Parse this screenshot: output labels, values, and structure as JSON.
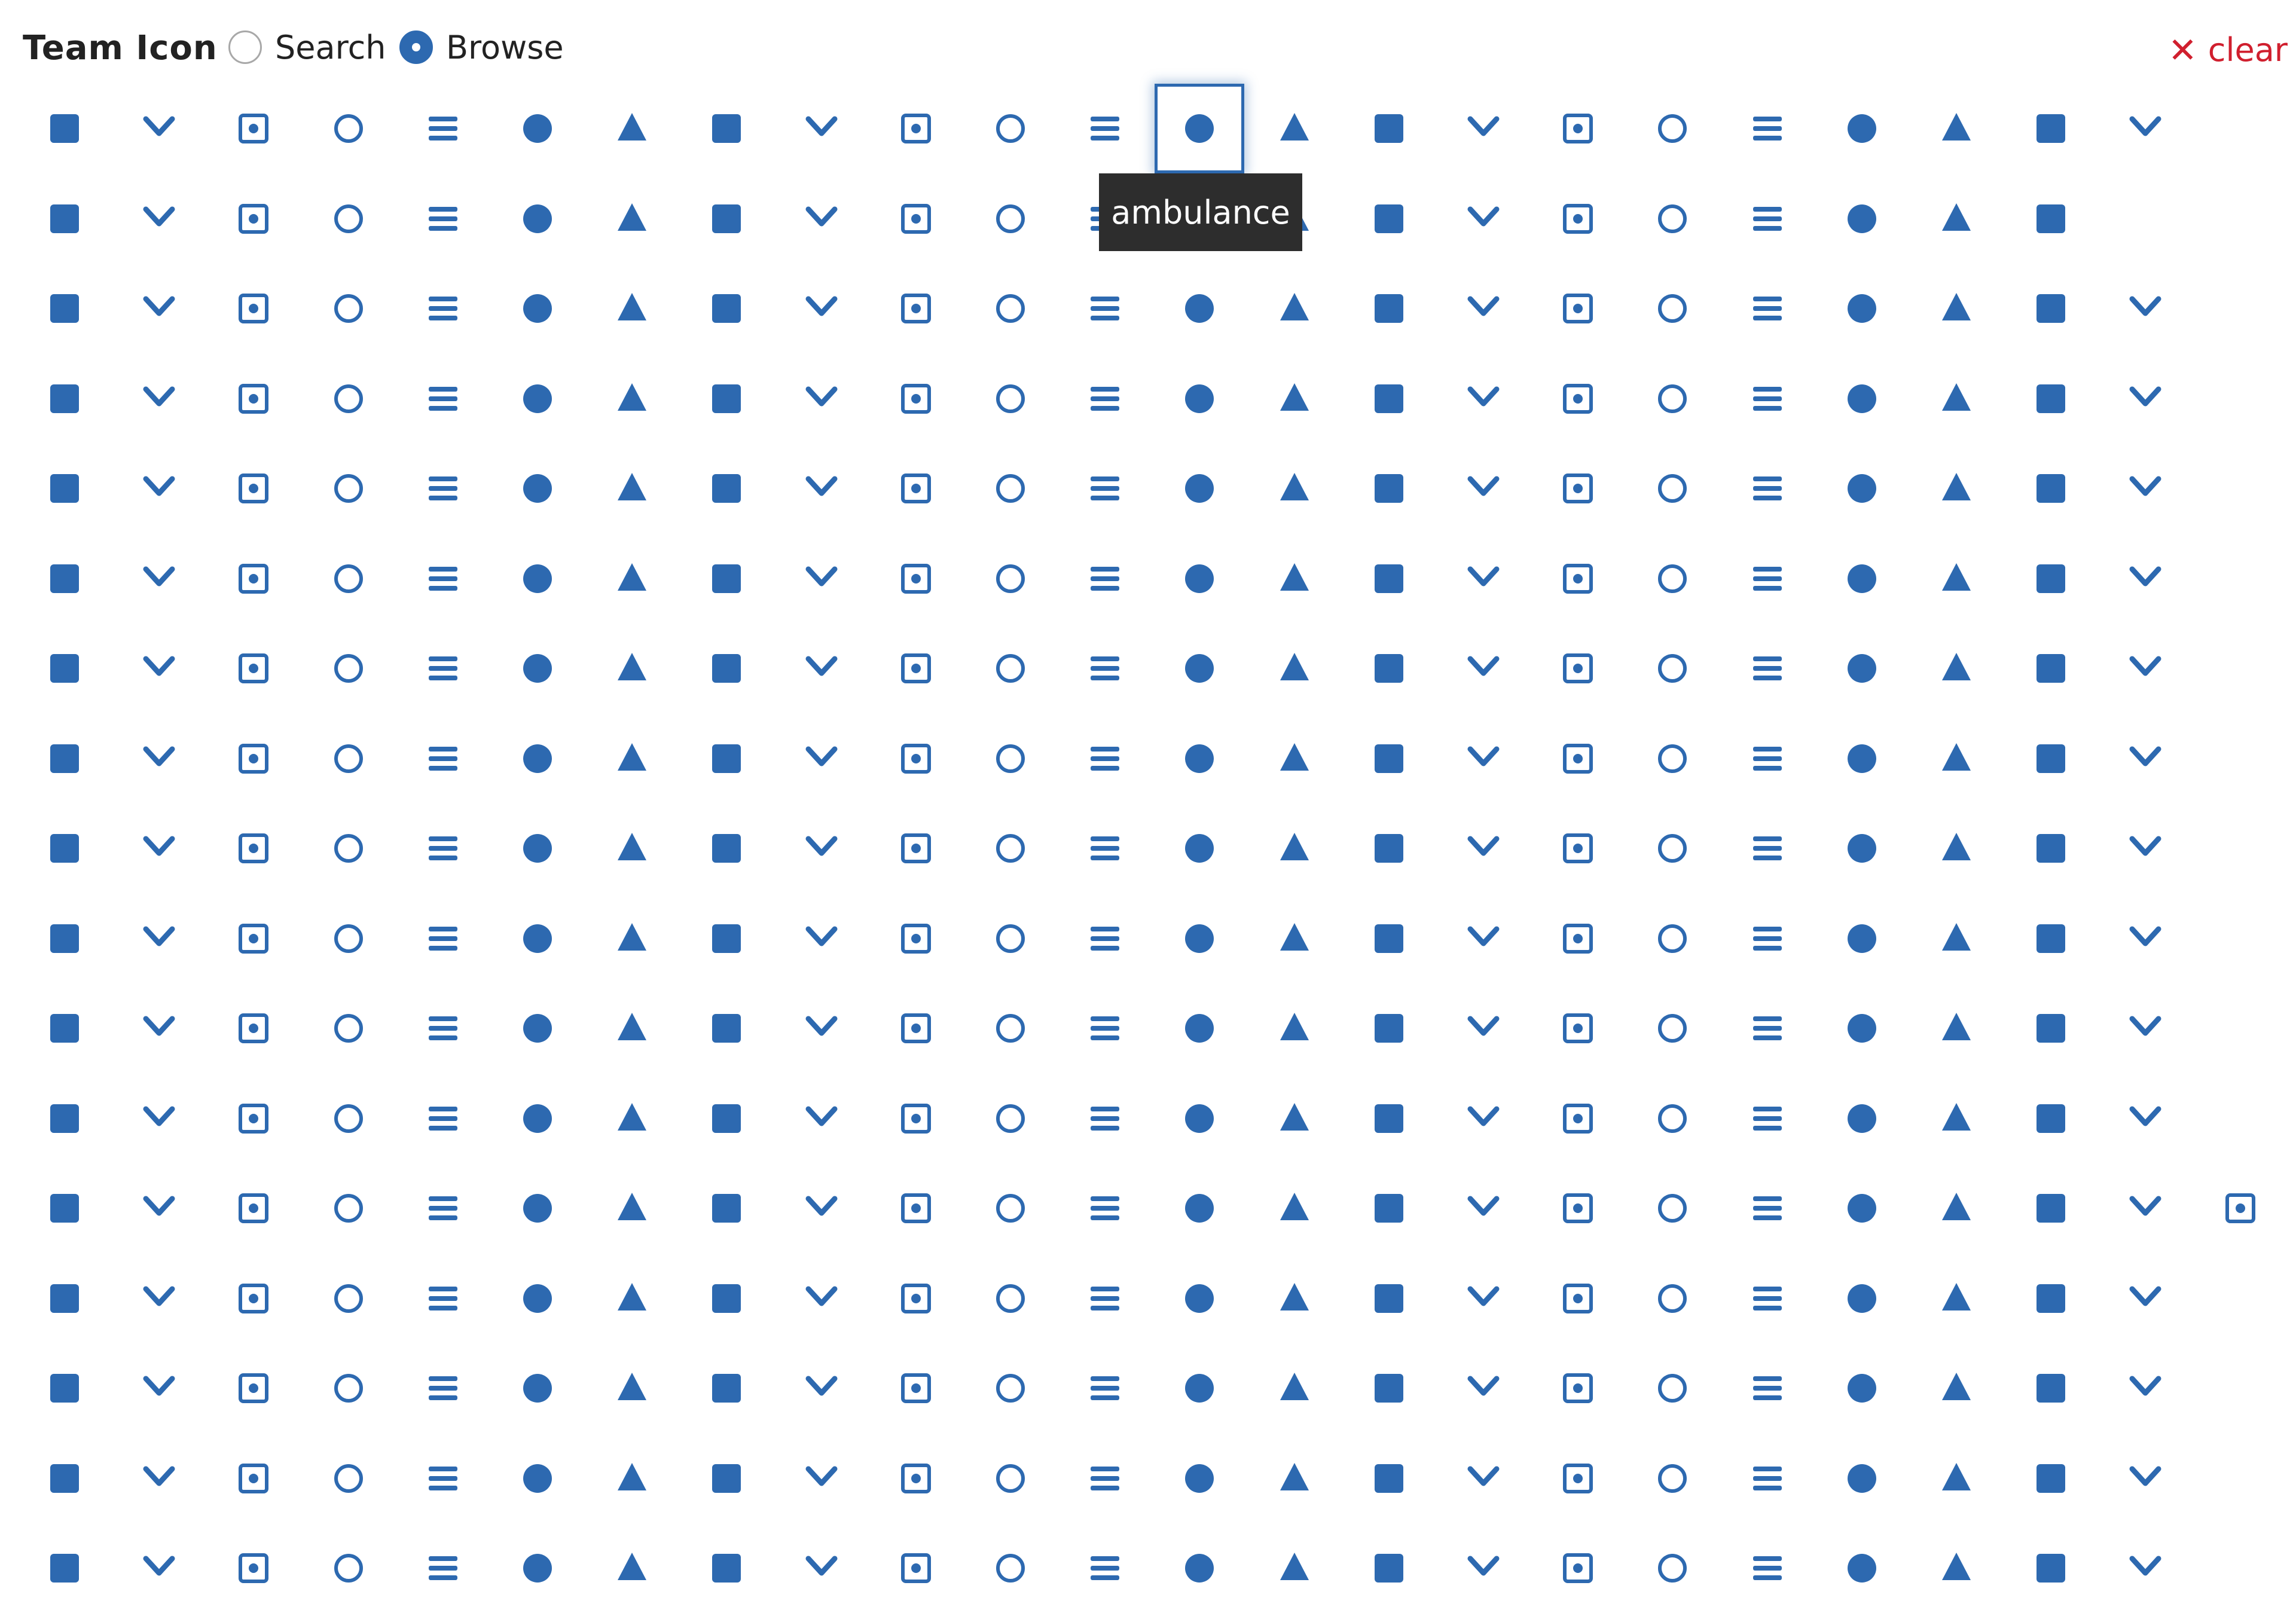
{
  "header": {
    "title": "Team Icon",
    "radio_search": "Search",
    "radio_browse": "Browse",
    "selected_mode": "browse",
    "clear_label": "clear"
  },
  "tooltip": {
    "text": "ambulance"
  },
  "colors": {
    "icon": "#2d69b0",
    "accent": "#2d69b0",
    "clear": "#d01f2e"
  },
  "selected_icon": "ambulance",
  "icon_rows": [
    [
      "ad-icon",
      "address-book-icon",
      "address-book-outline-icon",
      "address-card-icon",
      "address-card-outline-icon",
      "adjust-icon",
      "air-freshener-icon",
      "align-center-icon",
      "align-justify-icon",
      "align-left-icon",
      "align-right-icon",
      "allergies-icon",
      "ambulance-icon",
      "american-sign-language-icon",
      "anchor-icon",
      "angle-double-down-icon",
      "angle-double-down-bold-icon",
      "angle-double-left-icon",
      "angle-double-left-bold-icon",
      "angle-double-right-icon",
      "angle-double-right-bold-icon",
      "angle-double-up-icon",
      "angle-double-up-bold-icon"
    ],
    [
      "angle-down-icon",
      "angle-down-bold-icon",
      "angle-left-icon",
      "angle-left-bold-icon",
      "angle-right-icon",
      "angle-right-bold-icon",
      "angle-up-icon",
      "angle-up-bold-icon",
      "angry-icon",
      "angry-outline-icon",
      "apple-icon",
      "archive-icon",
      "archway-icon",
      "arrow-alt-circle-down-icon",
      "arrow-circle-down-icon",
      "arrow-alt-circle-left-icon",
      "arrow-circle-left-icon",
      "arrow-alt-circle-down-outline-icon",
      "arrow-alt-circle-left-outline-icon",
      "arrow-alt-circle-right-outline-icon",
      "arrow-alt-circle-up-outline-icon",
      "arrow-alt-circle-right-icon"
    ],
    [
      "arrow-circle-right-icon",
      "arrow-circle-up-icon",
      "arrow-alt-circle-up-icon",
      "arrow-down-icon",
      "arrow-left-icon",
      "arrow-right-icon",
      "arrow-up-icon",
      "arrows-alt-icon",
      "expand-arrows-icon",
      "arrows-alt-h-icon",
      "arrows-alt-v-icon",
      "assistive-listening-icon",
      "asterisk-icon",
      "at-icon",
      "atlas-icon",
      "atom-icon",
      "audio-description-icon",
      "award-icon",
      "baby-icon",
      "baby-carriage-icon",
      "backspace-icon",
      "backward-icon",
      "bacon-icon"
    ],
    [
      "bahai-icon",
      "bacterium-icon",
      "balance-scale-icon",
      "balance-scale-left-icon",
      "balance-scale-right-icon",
      "ban-icon",
      "band-aid-icon",
      "barcode-chart-icon",
      "barcode-icon",
      "bars-icon",
      "baseball-icon",
      "basketball-icon",
      "bath-icon",
      "battery-empty-icon",
      "battery-full-icon",
      "battery-half-icon",
      "battery-quarter-icon",
      "battery-three-quarters-icon",
      "bed-icon",
      "beer-icon",
      "bell-icon",
      "bell-outline-icon",
      "bell-slash-icon"
    ],
    [
      "bell-slash-outline-icon",
      "bezier-curve-icon",
      "bicycle-icon",
      "biking-icon",
      "binoculars-icon",
      "biohazard-icon",
      "birthday-cake-icon",
      "blender-icon",
      "blind-icon",
      "blog-icon",
      "bold-icon",
      "bolt-icon",
      "bomb-icon",
      "bone-icon",
      "book-icon",
      "book-dead-icon",
      "book-medical-icon",
      "book-open-icon",
      "book-reader-icon",
      "bookmark-icon",
      "bookmark-outline-icon",
      "border-all-icon",
      "border-none-icon"
    ],
    [
      "border-style-icon",
      "bowling-ball-icon",
      "box-icon",
      "box-open-icon",
      "inbox-box-icon",
      "boxes-icon",
      "braille-icon",
      "brain-icon",
      "bread-slice-icon",
      "briefcase-icon",
      "briefcase-medical-icon",
      "broadcast-tower-icon",
      "broom-icon",
      "brush-icon",
      "bug-icon",
      "building-icon",
      "building-outline-icon",
      "bullhorn-icon",
      "bullseye-icon",
      "bullseye-outline-icon",
      "burn-icon",
      "bus-icon",
      "bus-alt-icon"
    ],
    [
      "business-time-icon",
      "calculator-icon",
      "calendar-icon",
      "calendar-alt-icon",
      "calendar-check-icon",
      "calendar-check-outline-icon",
      "calendar-day-icon",
      "calendar-minus-icon",
      "calendar-minus-outline-icon",
      "calendar-outline-icon",
      "calendar-plus-icon",
      "calendar-plus-outline-icon",
      "calendar-times-icon",
      "calendar-times-outline-icon",
      "calendar-week-icon",
      "camera-icon",
      "camera-retro-icon",
      "campground-icon",
      "candy-cane-icon",
      "capsules-icon",
      "car-icon",
      "car-alt-icon",
      "car-battery-icon"
    ],
    [
      "car-crash-icon",
      "car-side-icon",
      "caravan-icon",
      "caret-down-icon",
      "caret-left-icon",
      "caret-right-icon",
      "caret-square-down-icon",
      "caret-square-left-icon",
      "caret-square-down-outline-icon",
      "caret-square-left-outline-icon",
      "caret-square-right-outline-icon",
      "caret-square-up-outline-icon",
      "caret-square-right-icon",
      "caret-square-up-icon",
      "caret-up-icon",
      "carrot-icon",
      "cart-arrow-down-icon",
      "cart-plus-icon",
      "cash-register-icon",
      "cat-icon",
      "closed-captioning-icon",
      "certificate-icon",
      "chain-broken-icon"
    ],
    [
      "chair-icon",
      "chalkboard-icon",
      "chalkboard-teacher-icon",
      "charging-station-icon",
      "check-icon",
      "check-circle-icon",
      "check-circle-outline-icon",
      "check-double-icon",
      "check-square-icon",
      "check-square-outline-icon",
      "check-square-thin-icon",
      "cheese-icon",
      "chess-icon",
      "chess-bishop-icon",
      "chess-board-icon",
      "chess-king-icon",
      "chess-knight-icon",
      "chess-pawn-icon",
      "chess-queen-icon",
      "chess-rook-icon",
      "chevron-circle-down-icon",
      "chevron-circle-left-icon",
      "chevron-circle-right-icon"
    ],
    [
      "chevron-circle-up-icon",
      "chevron-down-icon",
      "chevron-left-icon",
      "chevron-right-icon",
      "chevron-up-icon",
      "child-icon",
      "circle-icon",
      "circle-large-icon",
      "circle-outline-icon",
      "circle-thin-icon",
      "circle-notch-icon",
      "circle-light-icon",
      "city-icon",
      "clinic-medical-icon",
      "clipboard-copy-icon",
      "clipboard-icon",
      "clipboard-check-icon",
      "clipboard-list-icon",
      "clipboard-outline-icon",
      "clock-icon",
      "clock-outline-icon",
      "clone-outline-icon",
      "clone-icon"
    ],
    [
      "closed-captioning-solid-icon",
      "cloud-icon",
      "cloud-download-icon",
      "cloud-moon-icon",
      "cloud-moon-rain-icon",
      "cloud-rain-icon",
      "cloud-showers-heavy-icon",
      "cloud-sun-icon",
      "cloud-sun-rain-icon",
      "cloud-upload-icon",
      "cocktail-icon",
      "code-icon",
      "code-branch-icon",
      "coffee-icon",
      "cog-icon",
      "cogs-icon",
      "coins-icon",
      "columns-icon",
      "comment-icon",
      "comment-alt-icon",
      "comment-dollar-icon",
      "comment-medical-icon",
      "comment-outline-icon"
    ],
    [
      "comment-alt-outline-icon",
      "comment-slash-icon",
      "comment-dots-icon",
      "comment-dots-outline-icon",
      "comments-icon",
      "comments-dollar-icon",
      "comments-outline-icon",
      "compact-disc-icon",
      "compass-outline-icon",
      "compass-icon",
      "compress-icon",
      "compress-arrows-icon",
      "compress-alt-icon",
      "concierge-bell-icon",
      "cookie-icon",
      "cookie-bite-icon",
      "copyright-outline-icon",
      "copyright-icon",
      "couch-icon",
      "creative-commons-icon",
      "credit-card-icon",
      "credit-card-alt-icon",
      "crop-icon"
    ],
    [
      "crop-alt-icon",
      "crosshairs-icon",
      "crow-icon",
      "crown-icon",
      "crutch-icon",
      "cube-icon",
      "cubes-icon",
      "cutlery-icon",
      "database-icon",
      "deaf-icon",
      "desktop-icon",
      "dharmachakra-icon",
      "diagnoses-icon",
      "gem-outline-icon",
      "dice-icon",
      "dice-d20-icon",
      "dice-d6-icon",
      "dice-five-icon",
      "dice-four-icon",
      "dice-one-icon",
      "dice-six-icon",
      "dice-three-icon",
      "dice-two-icon",
      "digital-tachograph-icon"
    ],
    [
      "directions-icon",
      "disease-icon",
      "divide-icon",
      "dizzy-icon",
      "dizzy-outline-icon",
      "dna-icon",
      "dog-icon",
      "dolly-icon",
      "dolly-flatbed-icon",
      "donate-icon",
      "door-closed-icon",
      "door-open-icon",
      "dot-circle-icon",
      "dot-circle-outline-icon",
      "dot-circle-thin-icon",
      "dove-icon",
      "download-icon",
      "drafting-compass-icon",
      "dragon-icon",
      "draw-polygon-icon",
      "drum-icon",
      "drum-steelpan-icon",
      "drumstick-bite-icon"
    ],
    [
      "dumbbell-icon",
      "dumpster-icon",
      "dungeon-icon",
      "egg-icon",
      "eject-icon",
      "ellipsis-h-icon",
      "ellipsis-v-icon",
      "envelope-icon",
      "envelope-outline-icon",
      "envelope-open-icon",
      "envelope-open-outline-icon",
      "envelope-open-text-icon",
      "envelope-square-icon",
      "equals-icon",
      "eraser-icon",
      "ethernet-icon",
      "euro-sign-icon",
      "exchange-alt-icon",
      "exclamation-icon",
      "exclamation-circle-icon",
      "exclamation-triangle-icon",
      "expand-alt-icon",
      "expand-icon"
    ],
    [
      "external-link-icon",
      "external-link-square-icon",
      "eye-icon",
      "eye-slash-icon",
      "eye-dropper-icon",
      "eye-dropper-solid-icon",
      "fan-icon",
      "fast-backward-icon",
      "fast-forward-icon",
      "faucet-icon",
      "fax-icon",
      "feather-icon",
      "feather-alt-icon",
      "female-icon",
      "fighter-jet-icon",
      "file-icon",
      "file-alt-icon",
      "file-archive-icon",
      "file-audio-icon",
      "file-audio-outline-icon",
      "file-code-icon",
      "file-code-outline-icon",
      "file-contract-icon"
    ],
    [
      "file-csv-icon",
      "file-download-icon",
      "file-excel-icon",
      "file-excel-outline-icon",
      "file-export-icon",
      "file-image-icon",
      "file-image-outline-icon",
      "file-import-icon",
      "file-invoice-icon",
      "file-invoice-dollar-icon",
      "file-medical-icon",
      "file-medical-alt-icon",
      "file-outline-icon",
      "file-pdf-icon",
      "file-pdf-outline-icon",
      "file-powerpoint-icon",
      "file-powerpoint-outline-icon",
      "file-prescription-icon",
      "file-signature-icon",
      "file-upload-icon",
      "file-video-icon",
      "file-video-outline-icon",
      "file-word-icon"
    ]
  ]
}
